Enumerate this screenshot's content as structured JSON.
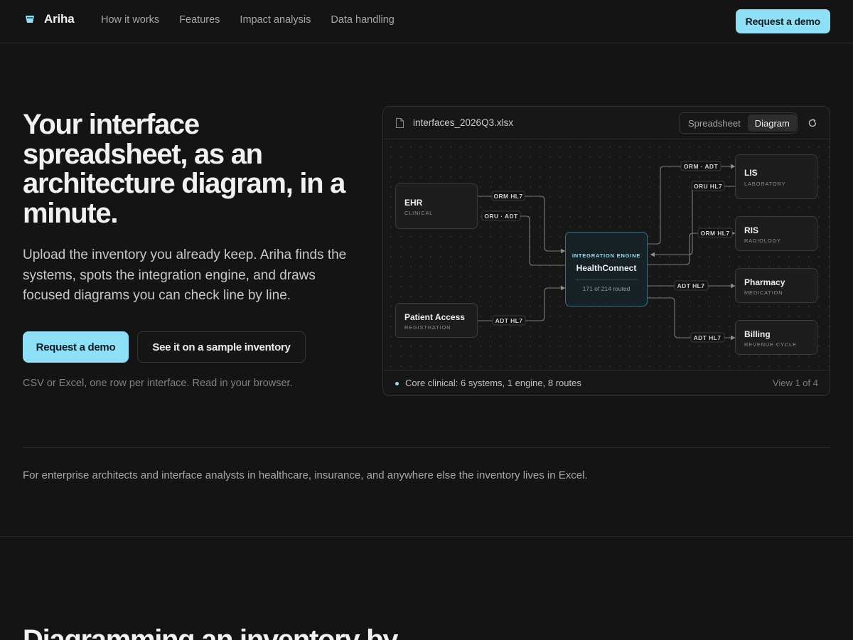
{
  "nav": {
    "brand": "Ariha",
    "links": [
      "How it works",
      "Features",
      "Impact analysis",
      "Data handling"
    ],
    "cta": "Request a demo"
  },
  "hero": {
    "title": "Your interface spreadsheet, as an architecture diagram, in a minute.",
    "subtitle": "Upload the inventory you already keep. Ariha finds the systems, spots the integration engine, and draws focused diagrams you can check line by line.",
    "primary_cta": "Request a demo",
    "secondary_cta": "See it on a sample inventory",
    "note": "CSV or Excel, one row per interface. Read in your browser."
  },
  "card": {
    "file_name": "interfaces_2026Q3.xlsx",
    "tabs": [
      "Spreadsheet",
      "Diagram"
    ],
    "active_tab": "Diagram",
    "footer_status": "Core clinical: 6 systems, 1 engine, 8 routes",
    "footer_view": "View 1 of 4",
    "accent": "#8ee0f7"
  },
  "diagram": {
    "engine": {
      "eyebrow": "INTEGRATION ENGINE",
      "name": "HealthConnect",
      "stat": "171 of 214 routed"
    },
    "systems": [
      {
        "id": "ehr",
        "name": "EHR",
        "role": "CLINICAL"
      },
      {
        "id": "pa",
        "name": "Patient Access",
        "role": "REGISTRATION"
      },
      {
        "id": "lis",
        "name": "LIS",
        "role": "LABORATORY"
      },
      {
        "id": "ris",
        "name": "RIS",
        "role": "RADIOLOGY"
      },
      {
        "id": "pharm",
        "name": "Pharmacy",
        "role": "MEDICATION"
      },
      {
        "id": "bill",
        "name": "Billing",
        "role": "REVENUE CYCLE"
      }
    ],
    "routes": [
      {
        "from": "ehr",
        "to": "engine",
        "label": "ORM HL7"
      },
      {
        "from": "engine",
        "to": "ehr",
        "label": "ORU · ADT"
      },
      {
        "from": "pa",
        "to": "engine",
        "label": "ADT HL7"
      },
      {
        "from": "engine",
        "to": "lis",
        "label": "ORM · ADT"
      },
      {
        "from": "lis",
        "to": "engine",
        "label": "ORU HL7"
      },
      {
        "from": "engine",
        "to": "ris",
        "label": "ORM HL7"
      },
      {
        "from": "engine",
        "to": "pharm",
        "label": "ADT HL7"
      },
      {
        "from": "engine",
        "to": "bill",
        "label": "ADT HL7"
      }
    ]
  },
  "audience": "For enterprise architects and interface analysts in healthcare, insurance, and anywhere else the inventory lives in Excel.",
  "next_section": {
    "title": "Diagramming an inventory by"
  }
}
